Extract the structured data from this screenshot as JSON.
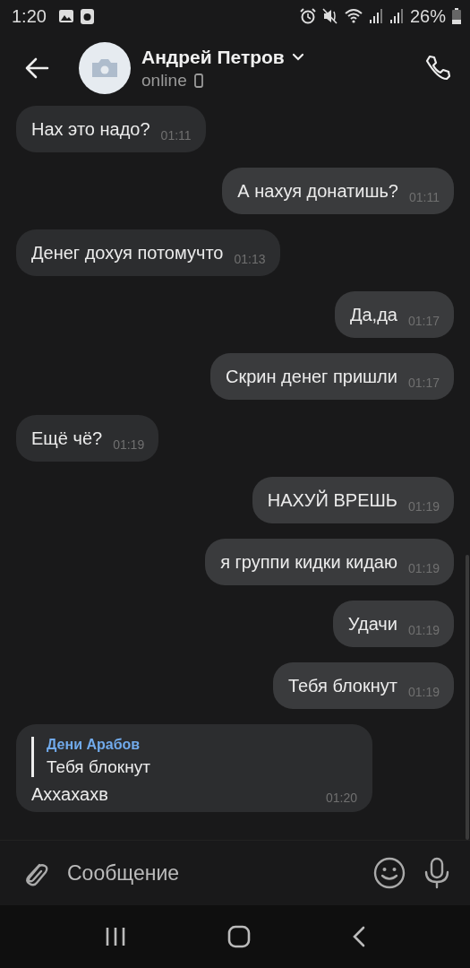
{
  "status_bar": {
    "time": "1:20",
    "battery": "26%"
  },
  "header": {
    "name": "Андрей Петров",
    "status": "online"
  },
  "messages": [
    {
      "kind": "text",
      "outgoing": false,
      "text": "Нах это надо?",
      "time": "01:11"
    },
    {
      "kind": "text",
      "outgoing": true,
      "text": "А нахуя донатишь?",
      "time": "01:11"
    },
    {
      "kind": "text",
      "outgoing": false,
      "text": "Денег дохуя потомучто",
      "time": "01:13"
    },
    {
      "kind": "text",
      "outgoing": true,
      "text": "Да,да",
      "time": "01:17"
    },
    {
      "kind": "text",
      "outgoing": true,
      "text": "Скрин денег пришли",
      "time": "01:17"
    },
    {
      "kind": "text",
      "outgoing": false,
      "text": "Ещё чё?",
      "time": "01:19"
    },
    {
      "kind": "text",
      "outgoing": true,
      "text": "НАХУЙ ВРЕШЬ",
      "time": "01:19"
    },
    {
      "kind": "text",
      "outgoing": true,
      "text": "я группи кидки кидаю",
      "time": "01:19"
    },
    {
      "kind": "text",
      "outgoing": true,
      "text": "Удачи",
      "time": "01:19"
    },
    {
      "kind": "text",
      "outgoing": true,
      "text": "Тебя блокнут",
      "time": "01:19"
    },
    {
      "kind": "reply",
      "outgoing": false,
      "quote_author": "Дени Арабов",
      "quote_text": "Тебя блокнут",
      "text": "Аххахахв",
      "time": "01:20"
    }
  ],
  "composer": {
    "placeholder": "Сообщение"
  }
}
